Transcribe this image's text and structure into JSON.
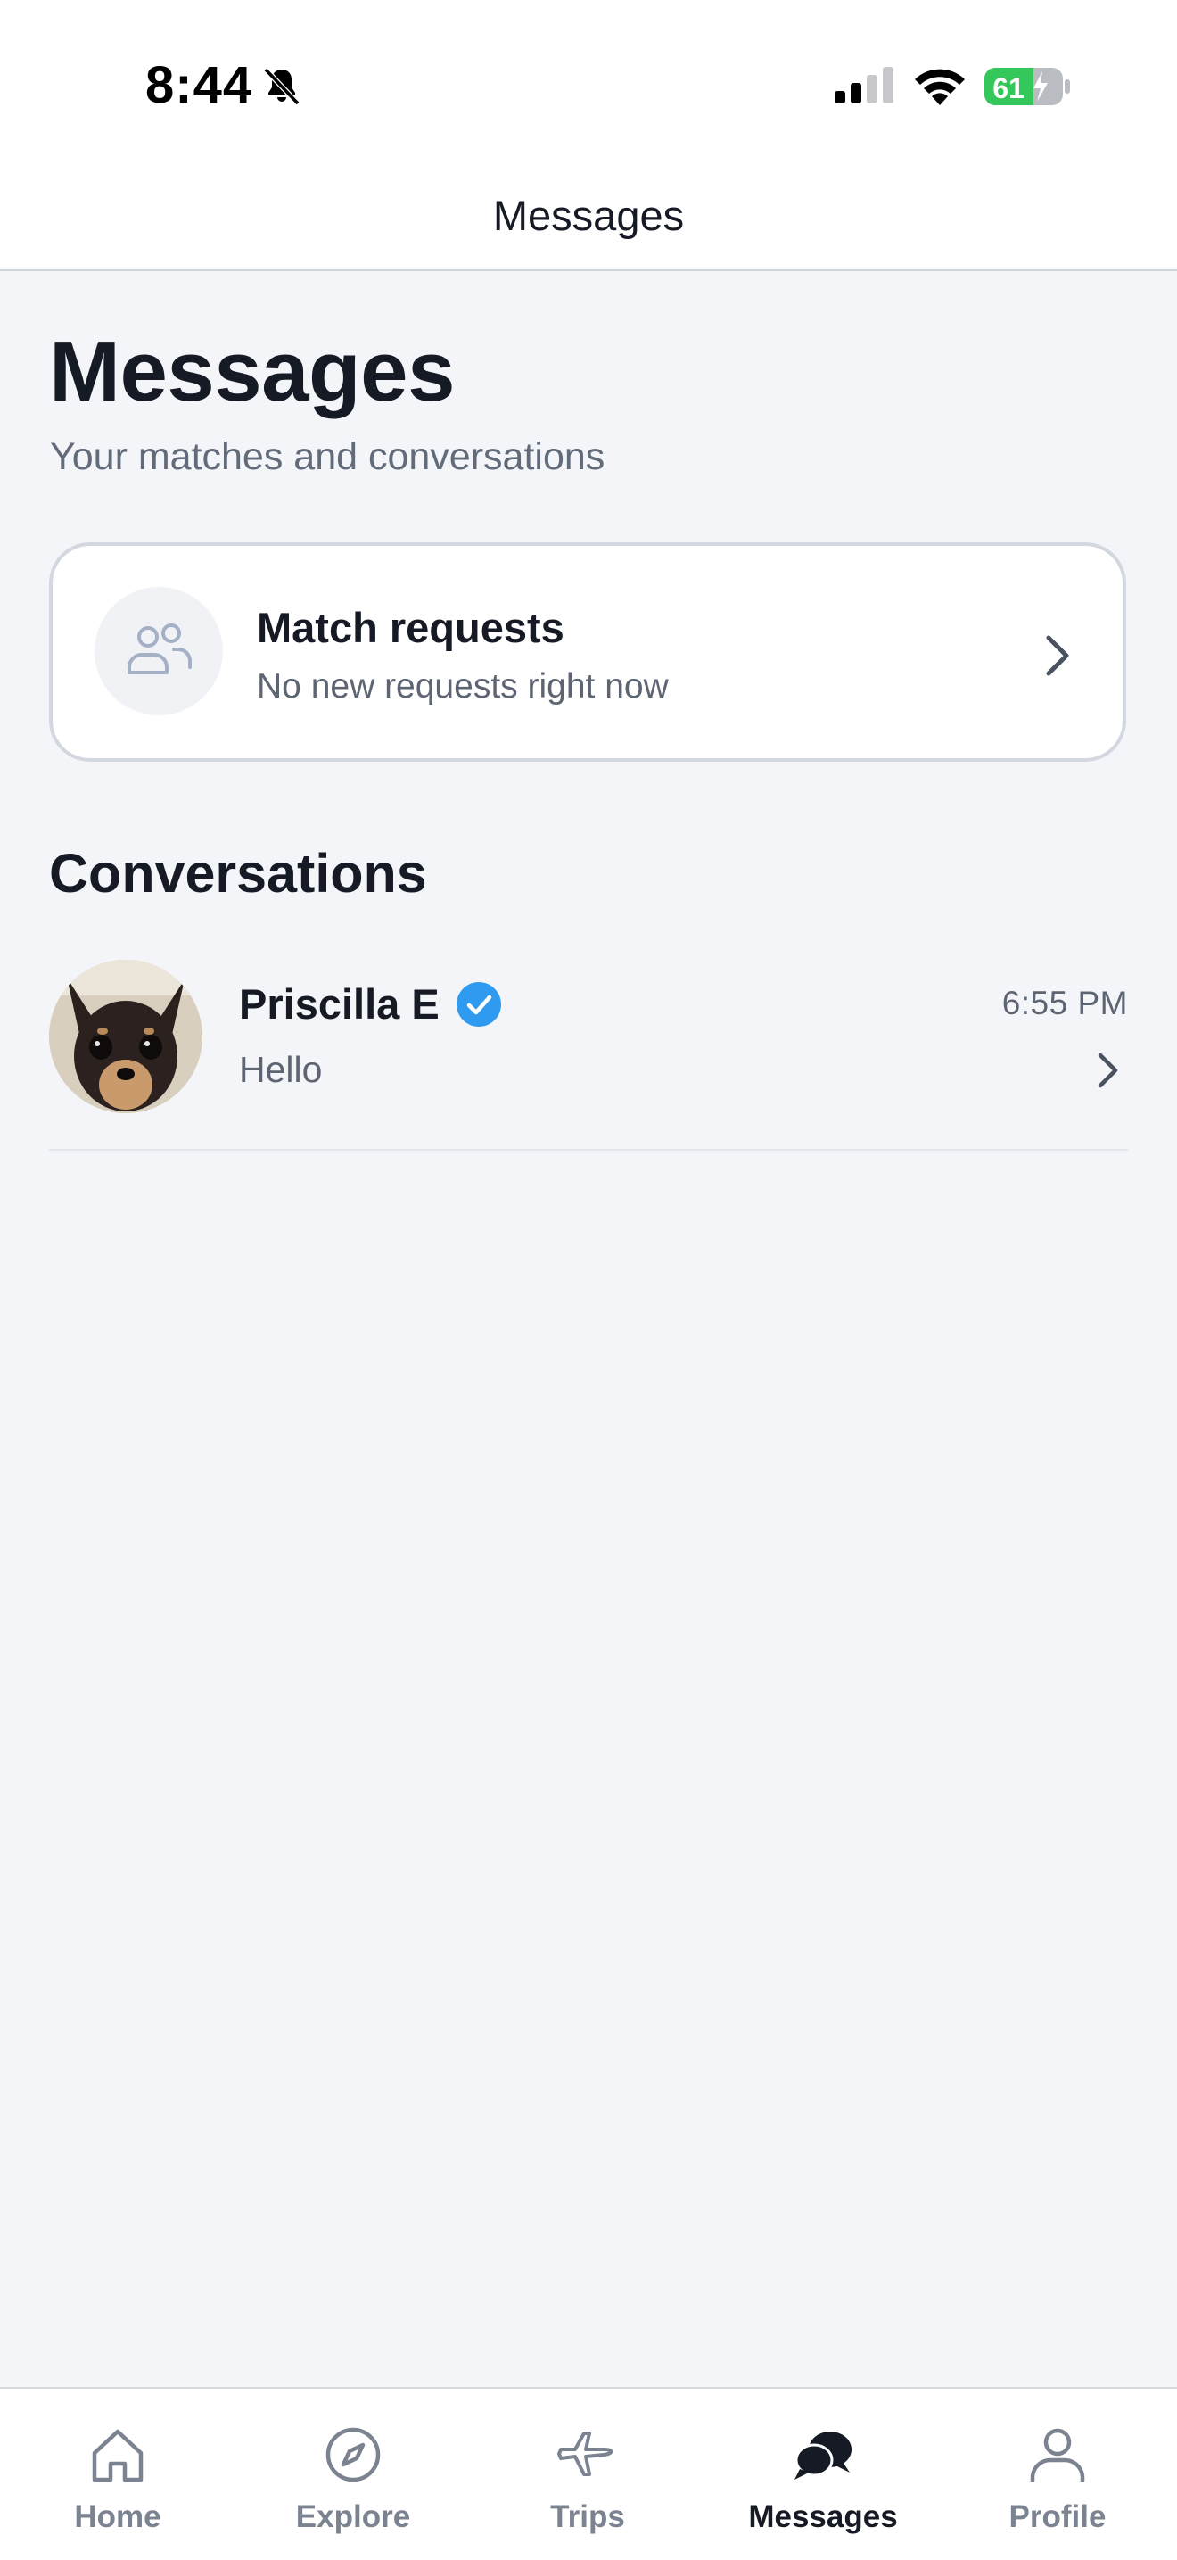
{
  "status_bar": {
    "time": "8:44",
    "battery": "61"
  },
  "nav": {
    "title": "Messages"
  },
  "page": {
    "title": "Messages",
    "subtitle": "Your matches and conversations"
  },
  "match_requests": {
    "title": "Match requests",
    "subtitle": "No new requests right now"
  },
  "conversations": {
    "section_title": "Conversations",
    "items": [
      {
        "name": "Priscilla E",
        "preview": "Hello",
        "time": "6:55 PM",
        "verified": true
      }
    ]
  },
  "tabs": [
    {
      "label": "Home",
      "icon": "home-icon",
      "active": false
    },
    {
      "label": "Explore",
      "icon": "compass-icon",
      "active": false
    },
    {
      "label": "Trips",
      "icon": "plane-icon",
      "active": false
    },
    {
      "label": "Messages",
      "icon": "chat-bubbles-icon",
      "active": true
    },
    {
      "label": "Profile",
      "icon": "person-icon",
      "active": false
    }
  ],
  "colors": {
    "background": "#f4f5f9",
    "text_primary": "#151a24",
    "text_secondary": "#5d6572",
    "verified_blue": "#2f9bf0",
    "battery_green": "#34c759",
    "tab_inactive": "#7b8391"
  }
}
